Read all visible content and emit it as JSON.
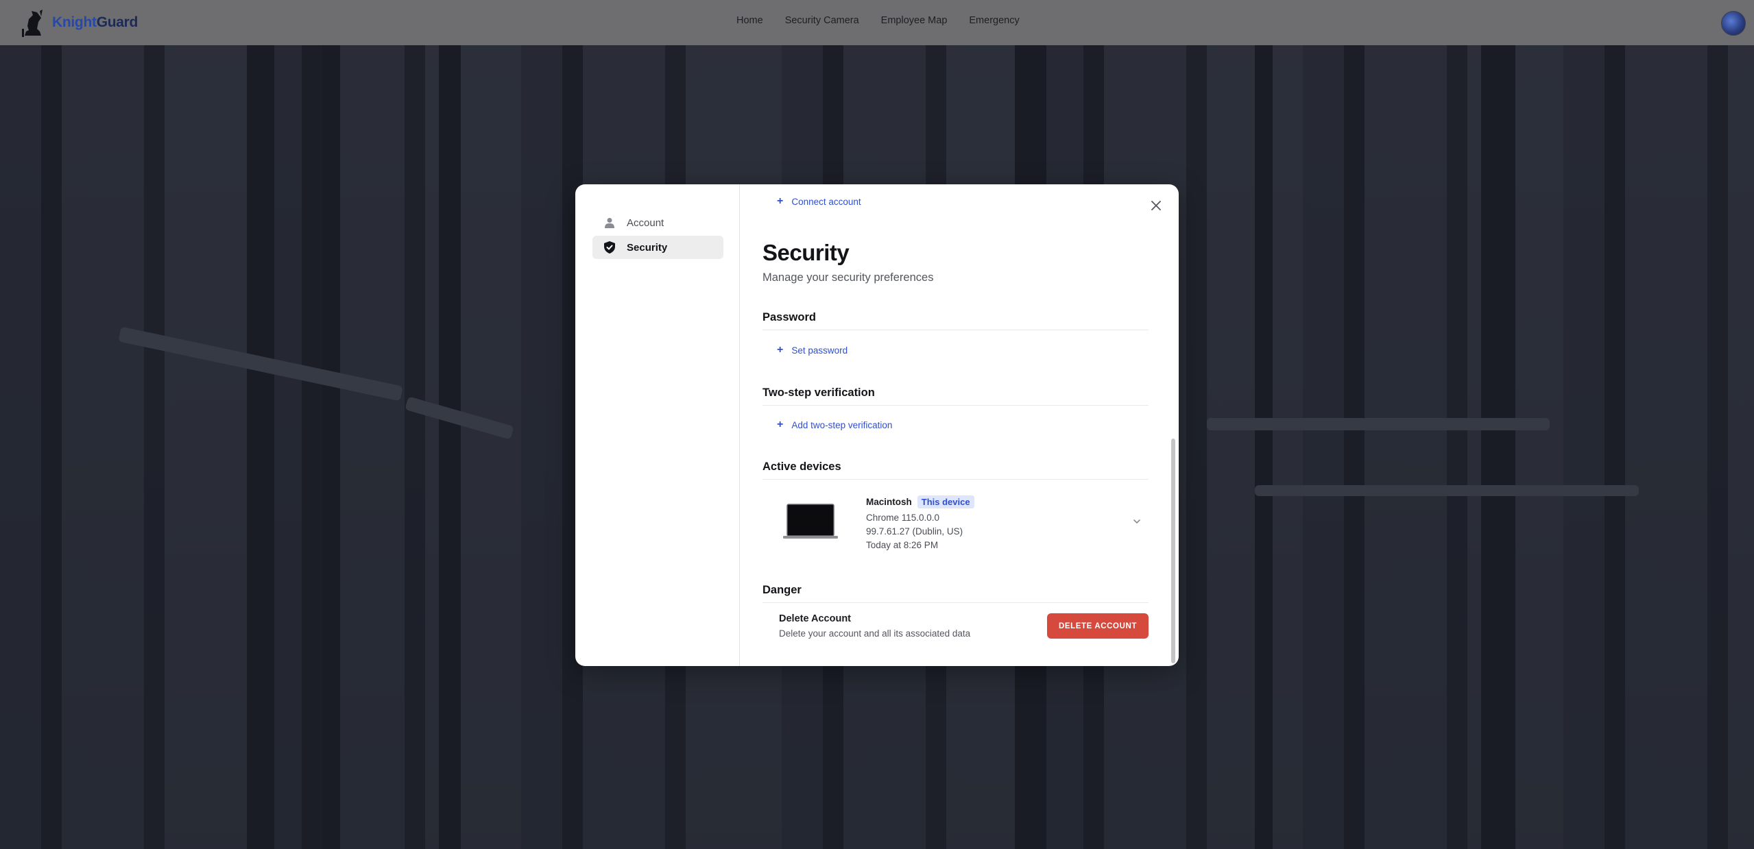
{
  "app": {
    "brand_part1": "Knight",
    "brand_part2": "Guard"
  },
  "nav": {
    "items": [
      "Home",
      "Security Camera",
      "Employee Map",
      "Emergency"
    ]
  },
  "modal": {
    "sidebar": {
      "items": [
        {
          "label": "Account",
          "icon": "person-icon",
          "active": false
        },
        {
          "label": "Security",
          "icon": "shield-check-icon",
          "active": true
        }
      ]
    },
    "connect_account": "Connect account",
    "title": "Security",
    "subtitle": "Manage your security preferences",
    "password": {
      "heading": "Password",
      "action": "Set password"
    },
    "two_step": {
      "heading": "Two-step verification",
      "action": "Add two-step verification"
    },
    "devices": {
      "heading": "Active devices",
      "list": [
        {
          "name": "Macintosh",
          "badge": "This device",
          "browser": "Chrome 115.0.0.0",
          "location": "99.7.61.27 (Dublin, US)",
          "last_active": "Today at 8:26 PM"
        }
      ]
    },
    "danger": {
      "heading": "Danger",
      "title": "Delete Account",
      "description": "Delete your account and all its associated data",
      "button": "DELETE ACCOUNT"
    }
  },
  "colors": {
    "accent": "#2f4fd1",
    "danger": "#d54a3c",
    "badge_bg": "#dfe5fb",
    "topbar": "#6e6e70"
  }
}
